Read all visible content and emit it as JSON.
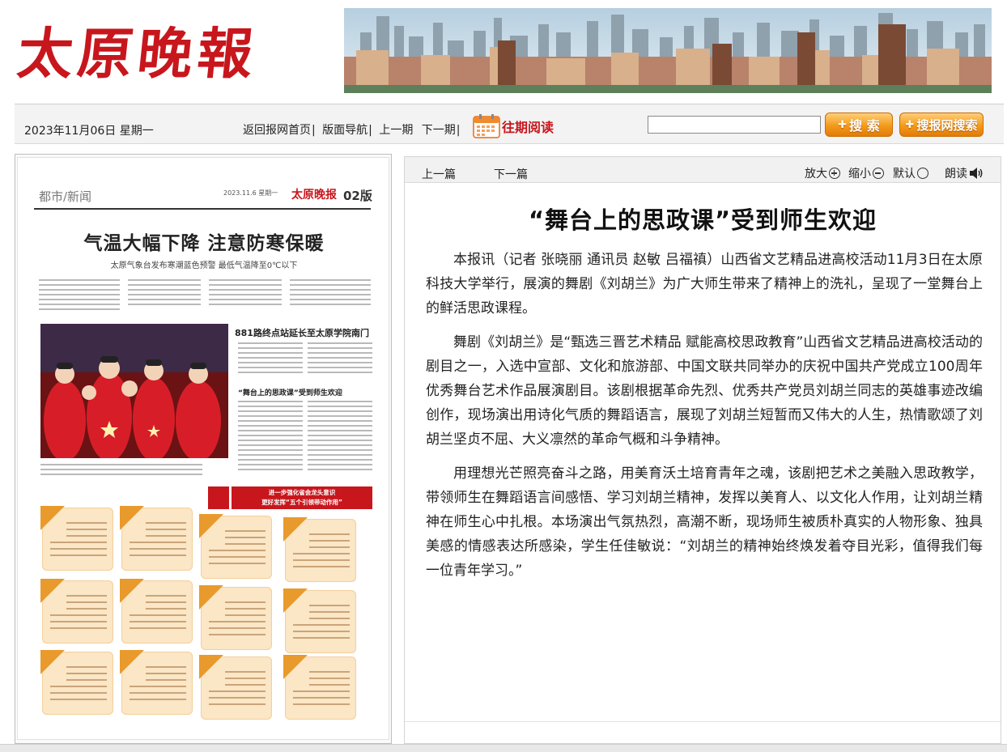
{
  "brand": {
    "logo_text": "太原晚報"
  },
  "toolbar": {
    "date": "2023年11月06日 星期一",
    "nav": [
      {
        "label": "返回报网首页"
      },
      {
        "label": "版面导航"
      },
      {
        "label": "上一期"
      },
      {
        "label": "下一期"
      }
    ],
    "archive_label": "往期阅读",
    "search_placeholder": "",
    "search_button": "搜 索",
    "site_search_button": "搜报网搜索"
  },
  "page_preview": {
    "section": "都市/新闻",
    "date": "2023.11.6  星期一",
    "mini_logo": "太原晚报",
    "page_number": "02版",
    "headline": "气温大幅下降 注意防寒保暖",
    "subheadline": "太原气象台发布寒潮蓝色预警 最低气温降至0℃以下",
    "story2_headline": "881路终点站延长至太原学院南门",
    "story3_headline": "“舞台上的思政课”受到师生欢迎",
    "ribbon_line1": "进一步强化省会龙头意识",
    "ribbon_line2": "更好发挥“五个引领带动作用”"
  },
  "article": {
    "prev_label": "上一篇",
    "next_label": "下一篇",
    "zoom_in_label": "放大",
    "zoom_out_label": "缩小",
    "reset_label": "默认",
    "read_aloud_label": "朗读",
    "title": "“舞台上的思政课”受到师生欢迎",
    "paragraphs": [
      "本报讯（记者 张晓丽 通讯员 赵敏 吕福禛）山西省文艺精品进高校活动11月3日在太原科技大学举行，展演的舞剧《刘胡兰》为广大师生带来了精神上的洗礼，呈现了一堂舞台上的鲜活思政课程。",
      "舞剧《刘胡兰》是“甄选三晋艺术精品 赋能高校思政教育”山西省文艺精品进高校活动的剧目之一，入选中宣部、文化和旅游部、中国文联共同举办的庆祝中国共产党成立100周年优秀舞台艺术作品展演剧目。该剧根据革命先烈、优秀共产党员刘胡兰同志的英雄事迹改编创作，现场演出用诗化气质的舞蹈语言，展现了刘胡兰短暂而又伟大的人生，热情歌颂了刘胡兰坚贞不屈、大义凛然的革命气概和斗争精神。",
      "用理想光芒照亮奋斗之路，用美育沃土培育青年之魂，该剧把艺术之美融入思政教学，带领师生在舞蹈语言间感悟、学习刘胡兰精神，发挥以美育人、以文化人作用，让刘胡兰精神在师生心中扎根。本场演出气氛热烈，高潮不断，现场师生被质朴真实的人物形象、独具美感的情感表达所感染，学生任佳敏说：“刘胡兰的精神始终焕发着夺目光彩，值得我们每一位青年学习。”"
    ]
  },
  "colors": {
    "brand_red": "#c8161d",
    "button_orange": "#f39a1b"
  },
  "icons": [
    "calendar-icon",
    "zoom-in-icon",
    "zoom-out-icon",
    "reset-icon",
    "speaker-icon",
    "search-glyph-icon"
  ]
}
